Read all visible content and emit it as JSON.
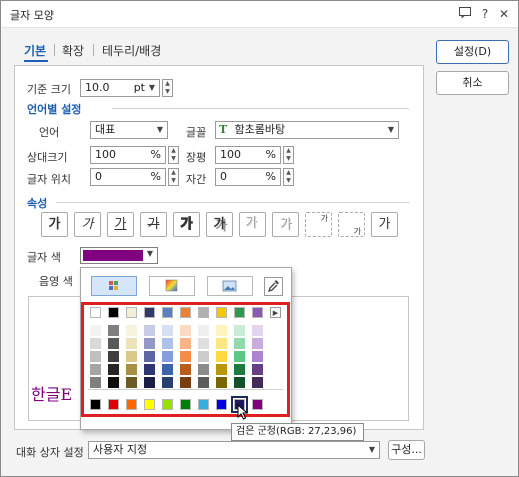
{
  "window": {
    "title": "글자 모양"
  },
  "tabs": [
    {
      "label": "기본"
    },
    {
      "label": "확장"
    },
    {
      "label": "테두리/배경"
    }
  ],
  "buttons": {
    "ok": "설정(D)",
    "cancel": "취소",
    "configure": "구성..."
  },
  "base_size": {
    "label": "기준 크기",
    "value": "10.0",
    "unit": "pt"
  },
  "lang_section": {
    "title": "언어별 설정"
  },
  "language": {
    "label": "언어",
    "value": "대표"
  },
  "font": {
    "label": "글꼴",
    "value": "함초롬바탕",
    "icon": "truetype-icon"
  },
  "relative_size": {
    "label": "상대크기",
    "value": "100",
    "unit": "%"
  },
  "width_ratio": {
    "label": "장평",
    "value": "100",
    "unit": "%"
  },
  "char_position": {
    "label": "글자 위치",
    "value": "0",
    "unit": "%"
  },
  "spacing": {
    "label": "자간",
    "value": "0",
    "unit": "%"
  },
  "attr_section": {
    "title": "속성"
  },
  "attributes": [
    {
      "glyph": "가",
      "name": "bold"
    },
    {
      "glyph": "가",
      "name": "italic"
    },
    {
      "glyph": "가",
      "name": "underline"
    },
    {
      "glyph": "가",
      "name": "strikethrough"
    },
    {
      "glyph": "가",
      "name": "outline"
    },
    {
      "glyph": "가",
      "name": "shadow"
    },
    {
      "glyph": "가",
      "name": "emboss"
    },
    {
      "glyph": "가",
      "name": "engrave"
    },
    {
      "glyph": "가",
      "name": "superscript"
    },
    {
      "glyph": "가",
      "name": "subscript"
    },
    {
      "glyph": "가",
      "name": "normal"
    }
  ],
  "text_color": {
    "label": "글자 색",
    "value": "#800080"
  },
  "shade_color": {
    "label": "음영 색"
  },
  "preview": {
    "text": "한글E"
  },
  "dialog_box_setting": {
    "label": "대화 상자 설정",
    "value": "사용자 지정"
  },
  "palette": {
    "tabs": [
      "theme-colors",
      "rgb-colors",
      "image-colors"
    ],
    "top_row": [
      "#ffffff",
      "#000000",
      "#f2eed8",
      "#333a66",
      "#5b7fc2",
      "#f08030",
      "#b0b0b0",
      "#f2c800",
      "#2a9a50",
      "#8a5ab0"
    ],
    "shades": [
      [
        "#f2f2f2",
        "#d9d9d9",
        "#bfbfbf",
        "#a6a6a6",
        "#7f7f7f"
      ],
      [
        "#7f7f7f",
        "#595959",
        "#3f3f3f",
        "#262626",
        "#0d0d0d"
      ],
      [
        "#f8f3dc",
        "#eee3b8",
        "#dcc88a",
        "#a88e44",
        "#6d5a24"
      ],
      [
        "#c9cce6",
        "#9398c6",
        "#5e66a4",
        "#2e3570",
        "#1b1f44"
      ],
      [
        "#d5e0f4",
        "#acc2e8",
        "#839fdb",
        "#3f63a8",
        "#283f70"
      ],
      [
        "#fcd9c1",
        "#f9b384",
        "#f48c48",
        "#b85c18",
        "#7a3d10"
      ],
      [
        "#efefef",
        "#dedede",
        "#cccccc",
        "#8a8a8a",
        "#5c5c5c"
      ],
      [
        "#fff3bf",
        "#ffe680",
        "#ffd940",
        "#b89800",
        "#7a6500"
      ],
      [
        "#c8ecd6",
        "#92d9ac",
        "#5cc684",
        "#1f7a40",
        "#14502a"
      ],
      [
        "#e3d5f0",
        "#c8abe0",
        "#ad82d1",
        "#654086",
        "#432a59"
      ]
    ],
    "standard": [
      "#000000",
      "#e00000",
      "#ff6600",
      "#ffff00",
      "#99e000",
      "#008000",
      "#33b0e0",
      "#0000e0",
      "#1b1760",
      "#800080"
    ],
    "tooltip": "검은 군청(RGB: 27,23,96)"
  }
}
